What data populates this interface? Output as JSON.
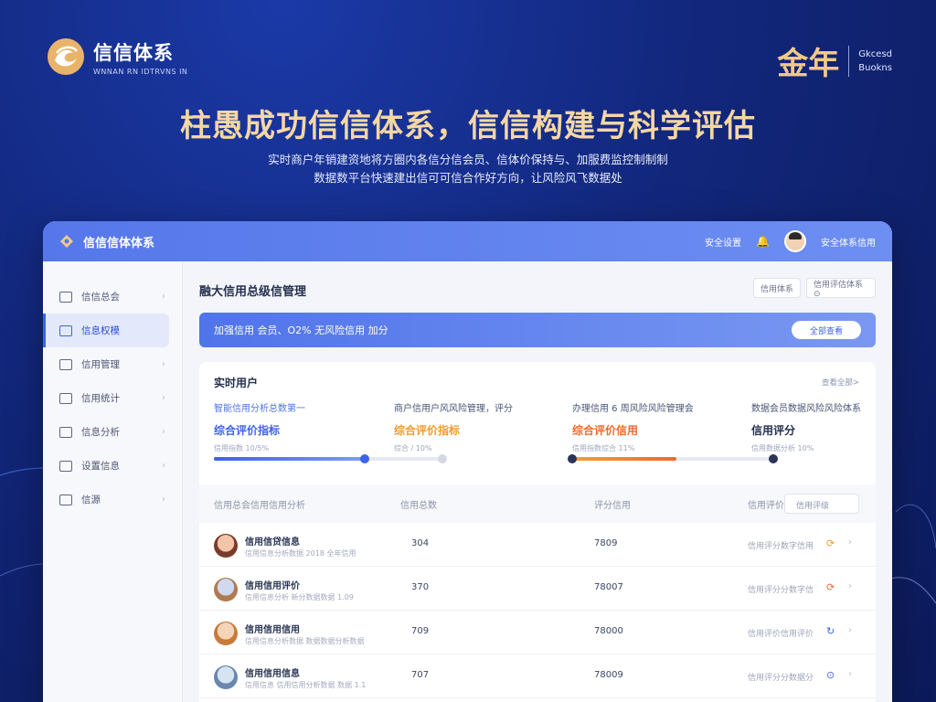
{
  "brand": {
    "name": "信信体系",
    "subtitle": "WNNAN RN IDTRVNS IN"
  },
  "partner": {
    "big": "金年",
    "line1": "Gkcesd",
    "line2": "Buokns"
  },
  "headline": "柱愚成功信信体系，信信构建与科学评估",
  "subline": {
    "line1": "实时商户年销建资地将方圈内各信分信会员、信体价保持与、加服费监控制制制",
    "line2": "数据数平台快速建出信可可信合作好方向，让风险风飞数据处"
  },
  "app": {
    "title": "信信信体体系",
    "topbar_link": "安全设置",
    "bell_icon": "bell-icon",
    "user_name": "安全体系信用"
  },
  "sidebar": {
    "items": [
      {
        "label": "信信总会",
        "icon": "dashboard-icon"
      },
      {
        "label": "信息权模",
        "icon": "model-icon"
      },
      {
        "label": "信用管理",
        "icon": "list-icon"
      },
      {
        "label": "信用统计",
        "icon": "chart-icon"
      },
      {
        "label": "信息分析",
        "icon": "analysis-icon"
      },
      {
        "label": "设置信息",
        "icon": "settings-icon"
      },
      {
        "label": "信源",
        "icon": "source-icon"
      }
    ]
  },
  "main": {
    "page_title": "融大信用总级信管理",
    "tool_btn_1": "信用体系",
    "tool_btn_2": "信用评估体系 ⊙",
    "banner": {
      "text": "加强信用 会员、O2% 无风险信用 加分",
      "button": "全部查看"
    },
    "card": {
      "title": "实时用户",
      "link": "查看全部>",
      "metrics": [
        {
          "head": "智能信用分析总数第一",
          "value": "综合评价指标",
          "note": "信用指数 10/5%"
        },
        {
          "head": "商户信用户风风险管理，评分",
          "value": "综合评价指标",
          "note": "综合 / 10%"
        },
        {
          "head": "办理信用 6 周风险风险管理会",
          "value": "综合评价信用",
          "note": "信用指数综合 11%"
        },
        {
          "head": "数据会员数据风险风险体系",
          "value": "信用评分",
          "note": "信用数据分析 10%"
        }
      ],
      "progress": [
        {
          "value": 0.66,
          "color": "#3d63e6"
        },
        {
          "value": 0.52,
          "color": "#ee6a2c"
        }
      ]
    },
    "table": {
      "headers": [
        "信用总会信用信用分析",
        "信用总数",
        "评分信用",
        "信用评价"
      ],
      "filter_placeholder": "信用评级",
      "rows": [
        {
          "name": "信用信贷信息",
          "sub": "信用信息分析数据 2018 全年信用",
          "c2": "304",
          "c3": "7809",
          "c4": "信用评分数字信用",
          "icon": "⟳",
          "icon_color": "#f09b2e"
        },
        {
          "name": "信用信用评价",
          "sub": "信用信息分析 新分数据数据 1.09",
          "c2": "370",
          "c3": "78007",
          "c4": "信用评分分数字信",
          "icon": "⟳",
          "icon_color": "#ee6a2c"
        },
        {
          "name": "信用信用信用",
          "sub": "信用信息分析数据 数据数据分析数据",
          "c2": "709",
          "c3": "78000",
          "c4": "信用评价信用评价",
          "icon": "↻",
          "icon_color": "#3d63e6"
        },
        {
          "name": "信用信用信息",
          "sub": "信用信息 信用信用分析数据 数据 1.1",
          "c2": "707",
          "c3": "78009",
          "c4": "信用评分分数据分",
          "icon": "⊙",
          "icon_color": "#3d63e6"
        }
      ]
    }
  }
}
